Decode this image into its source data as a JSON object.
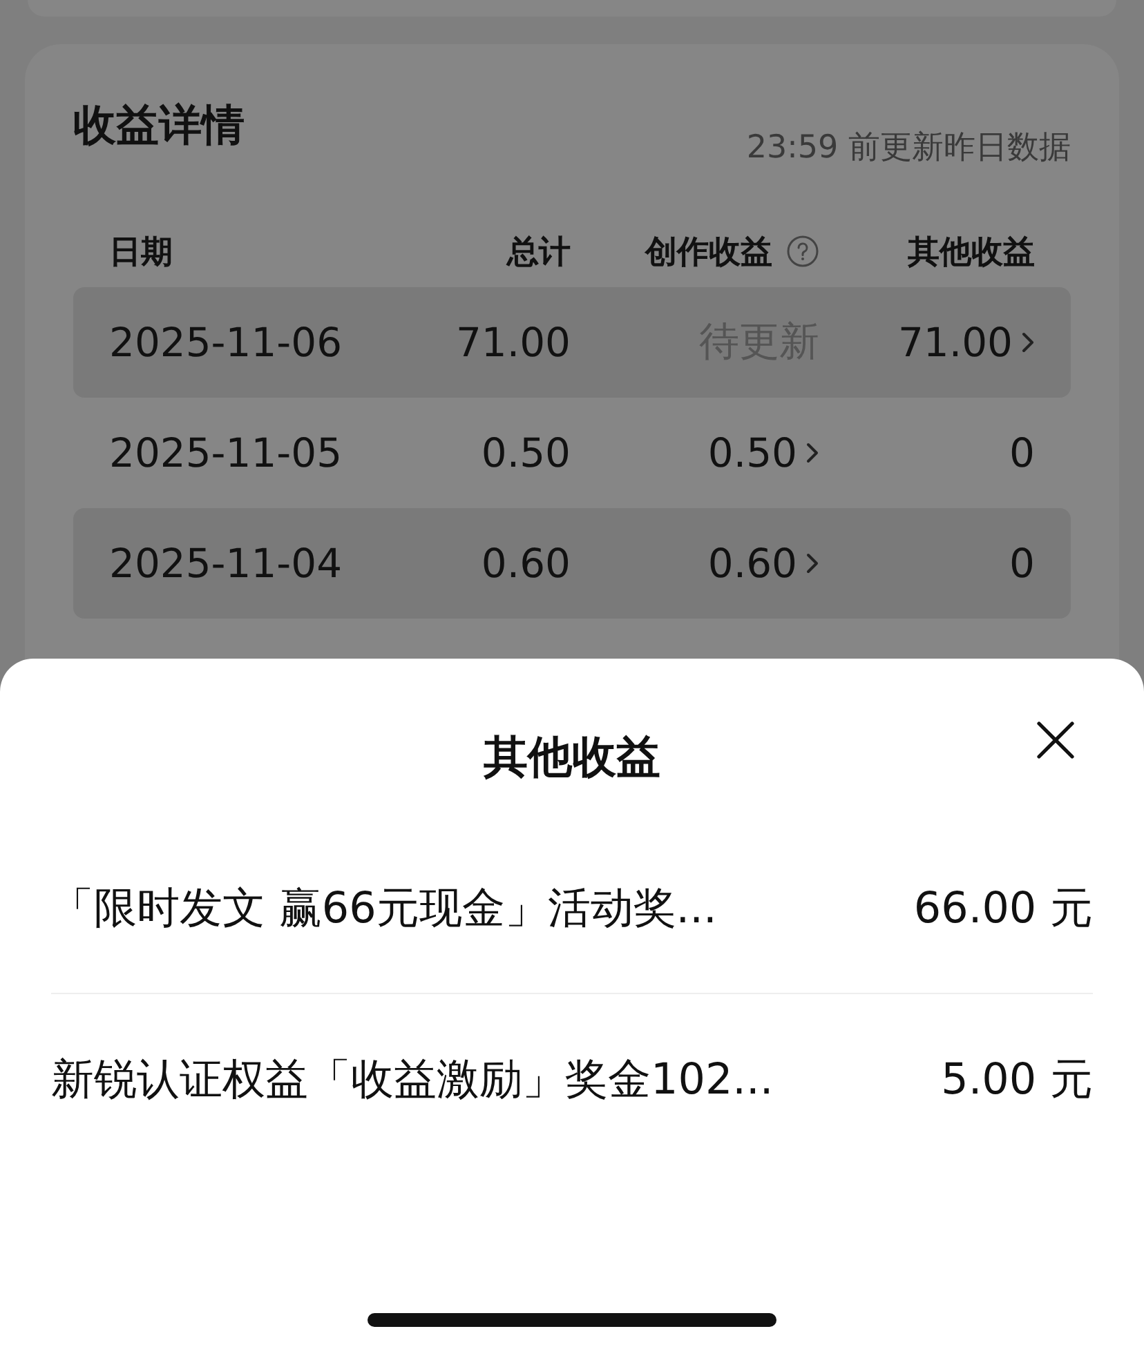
{
  "details": {
    "title": "收益详情",
    "note": "23:59 前更新昨日数据",
    "columns": [
      {
        "label": "日期",
        "help": false
      },
      {
        "label": "总计",
        "help": false
      },
      {
        "label": "创作收益",
        "help": true
      },
      {
        "label": "其他收益",
        "help": false
      }
    ],
    "rows": [
      {
        "date": "2025-11-06",
        "total": "71.00",
        "creation": {
          "text": "待更新",
          "muted": true,
          "chevron": false
        },
        "other": {
          "text": "71.00",
          "muted": false,
          "chevron": true
        }
      },
      {
        "date": "2025-11-05",
        "total": "0.50",
        "creation": {
          "text": "0.50",
          "muted": false,
          "chevron": true
        },
        "other": {
          "text": "0",
          "muted": false,
          "chevron": false
        }
      },
      {
        "date": "2025-11-04",
        "total": "0.60",
        "creation": {
          "text": "0.60",
          "muted": false,
          "chevron": true
        },
        "other": {
          "text": "0",
          "muted": false,
          "chevron": false
        }
      }
    ]
  },
  "sheet": {
    "title": "其他收益",
    "items": [
      {
        "label": "「限时发文 赢66元现金」活动奖...",
        "amount": "66.00 元"
      },
      {
        "label": "新锐认证权益「收益激励」奖金102...",
        "amount": "5.00 元"
      }
    ]
  }
}
